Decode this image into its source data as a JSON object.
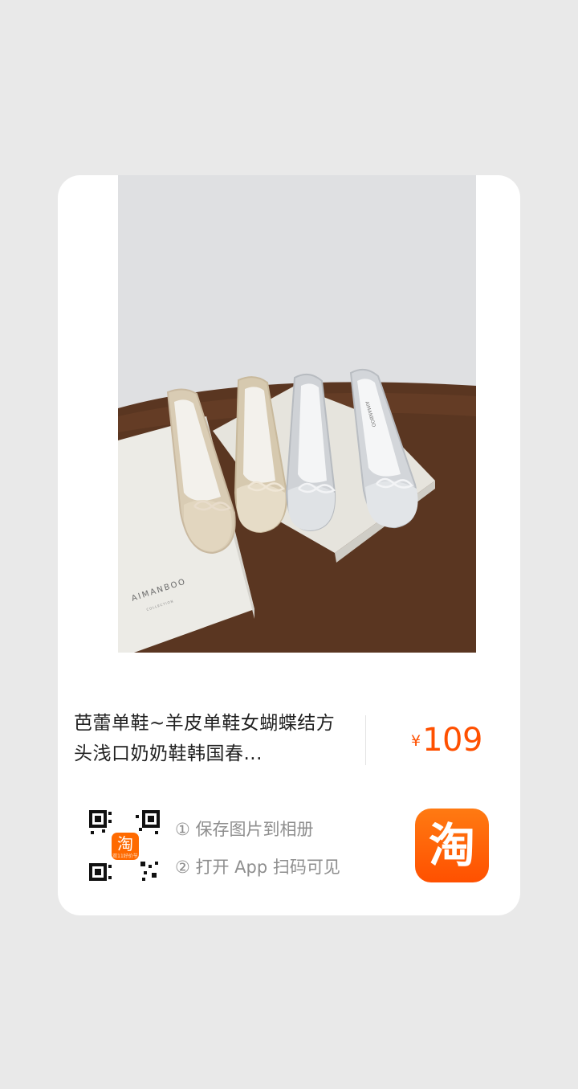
{
  "product": {
    "title": "芭蕾单鞋~羊皮单鞋女蝴蝶结方头浅口奶奶鞋韩国春...",
    "currency": "¥",
    "price": "109",
    "box_brand": "AIMANBOO",
    "box_sub": "COLLECTION",
    "insole_brand": "AIMANBOO"
  },
  "share": {
    "qr_badge_glyph": "淘",
    "qr_badge_sub": "双11好价节",
    "step1": "① 保存图片到相册",
    "step2": "② 打开 App 扫码可见",
    "app_icon_glyph": "淘"
  },
  "colors": {
    "price": "#ff5000",
    "app_icon": "#ff5000",
    "page_bg": "#e9e9e9"
  }
}
